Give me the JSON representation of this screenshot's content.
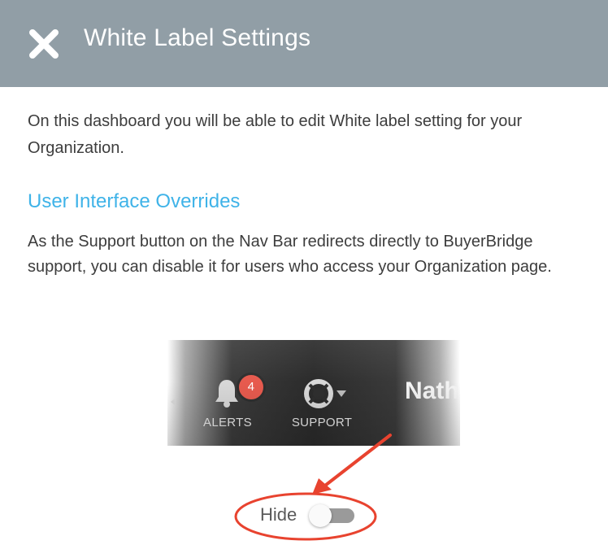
{
  "header": {
    "title": "White Label Settings",
    "close_icon": "close-icon",
    "background_color": "#919ea6"
  },
  "intro": {
    "text": "On this dashboard you will be able to edit White label setting for your Organization."
  },
  "section": {
    "title": "User Interface Overrides",
    "title_color": "#3fb3e8",
    "text": "As the Support button on the Nav Bar redirects directly to BuyerBridge support, you can disable it for users who access your Organization page."
  },
  "navbar_preview": {
    "alerts": {
      "label": "ALERTS",
      "badge_count": "4",
      "icon": "bell-icon",
      "badge_color": "#e75a4e"
    },
    "support": {
      "label": "SUPPORT",
      "icon": "lifebuoy-icon"
    },
    "user_name_partial": "Nath"
  },
  "annotation": {
    "arrow_color": "#e8432f",
    "highlight_color": "#e8432f"
  },
  "toggle": {
    "label": "Hide",
    "state": "off"
  }
}
